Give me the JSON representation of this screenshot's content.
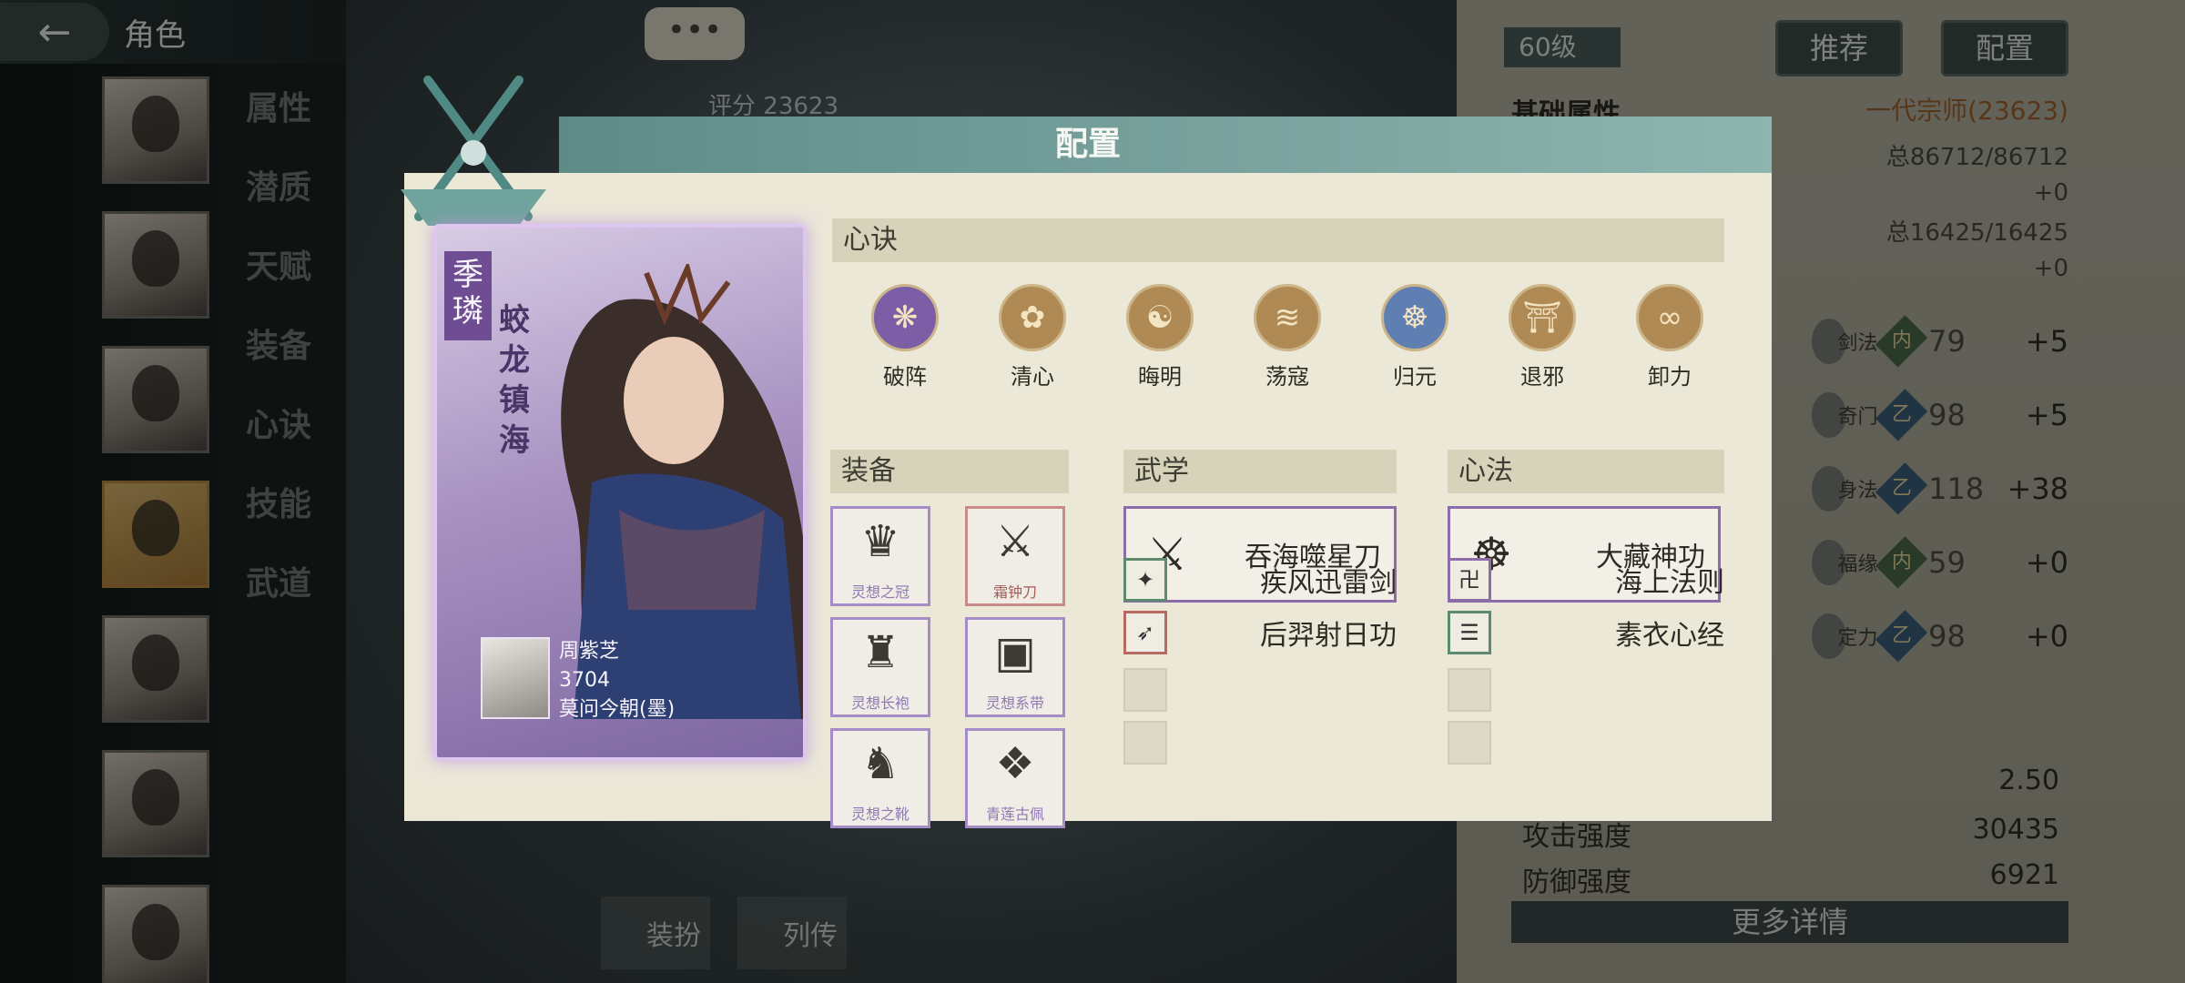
{
  "topbar": {
    "back_icon": "←",
    "title": "角色",
    "chat_icon": "•••",
    "score_label": "评分",
    "score_value": "23623"
  },
  "side_tabs": [
    "属性",
    "潜质",
    "天赋",
    "装备",
    "心诀",
    "技能",
    "武道"
  ],
  "right_panel": {
    "level": "60级",
    "recommend_label": "推荐",
    "config_label": "配置",
    "base_title": "基础属性",
    "grade": "一代宗师(23623)",
    "total1": "总86712/86712",
    "plus1": "+0",
    "total2": "总16425/16425",
    "plus2": "+0",
    "attrs": [
      {
        "name": "剑法",
        "gem": "内",
        "value": "79",
        "add": "+5",
        "color": "green"
      },
      {
        "name": "奇门",
        "gem": "乙",
        "value": "98",
        "add": "+5",
        "color": "blue"
      },
      {
        "name": "身法",
        "gem": "乙",
        "value": "118",
        "add": "+38",
        "color": "blue"
      },
      {
        "name": "福缘",
        "gem": "内",
        "value": "59",
        "add": "+0",
        "color": "green"
      },
      {
        "name": "定力",
        "gem": "乙",
        "value": "98",
        "add": "+0",
        "color": "blue"
      }
    ],
    "crit_value": "2.50",
    "attack_label": "攻击强度",
    "attack_value": "30435",
    "defense_label": "防御强度",
    "defense_value": "6921",
    "more_label": "更多详情"
  },
  "bottom_tabs": [
    "装扮",
    "列传"
  ],
  "modal": {
    "title": "配置",
    "character": {
      "name": "季璘",
      "title": "蛟龙镇海",
      "owner_name": "周紫芝",
      "owner_number": "3704",
      "owner_guild": "莫问今朝(墨)"
    },
    "xinjue_label": "心诀",
    "xinjue": [
      {
        "label": "破阵",
        "icon": "swirl-icon",
        "glyph": "❋",
        "color": "#7b5ea6"
      },
      {
        "label": "清心",
        "icon": "lotus-icon",
        "glyph": "✿",
        "color": "#b08a55"
      },
      {
        "label": "晦明",
        "icon": "moon-icon",
        "glyph": "☯",
        "color": "#b08a55"
      },
      {
        "label": "荡寇",
        "icon": "wave-icon",
        "glyph": "≋",
        "color": "#b08a55"
      },
      {
        "label": "归元",
        "icon": "meditate-icon",
        "glyph": "☸",
        "color": "#5f7fb2"
      },
      {
        "label": "退邪",
        "icon": "gate-icon",
        "glyph": "⛩",
        "color": "#b08a55"
      },
      {
        "label": "卸力",
        "icon": "spiral-icon",
        "glyph": "∞",
        "color": "#b08a55"
      }
    ],
    "equip_label": "装备",
    "equipment": [
      {
        "name": "灵想之冠",
        "icon": "crown-icon",
        "glyph": "♛",
        "frame": "purple"
      },
      {
        "name": "霜钟刀",
        "icon": "blade-icon",
        "glyph": "⚔",
        "frame": "red"
      },
      {
        "name": "灵想长袍",
        "icon": "robe-icon",
        "glyph": "♜",
        "frame": "purple"
      },
      {
        "name": "灵想系带",
        "icon": "belt-icon",
        "glyph": "▣",
        "frame": "purple"
      },
      {
        "name": "灵想之靴",
        "icon": "boots-icon",
        "glyph": "♞",
        "frame": "purple"
      },
      {
        "name": "青莲古佩",
        "icon": "pendant-icon",
        "glyph": "❖",
        "frame": "purple"
      }
    ],
    "wuxue_label": "武学",
    "wuxue_main": {
      "name": "吞海噬星刀",
      "icon": "swordsman-icon",
      "glyph": "⚔"
    },
    "wuxue_sub": [
      {
        "name": "疾风迅雷剑",
        "icon": "swift-sword-icon",
        "glyph": "✦",
        "frame": "green"
      },
      {
        "name": "后羿射日功",
        "icon": "archer-icon",
        "glyph": "➶",
        "frame": "red"
      }
    ],
    "xinfa_label": "心法",
    "xinfa_main": {
      "name": "大藏神功",
      "icon": "buddha-icon",
      "glyph": "☸"
    },
    "xinfa_sub": [
      {
        "name": "海上法则",
        "icon": "seal-icon",
        "glyph": "卍",
        "frame": "purple"
      },
      {
        "name": "素衣心经",
        "icon": "scroll-icon",
        "glyph": "☰",
        "frame": "green"
      }
    ]
  }
}
